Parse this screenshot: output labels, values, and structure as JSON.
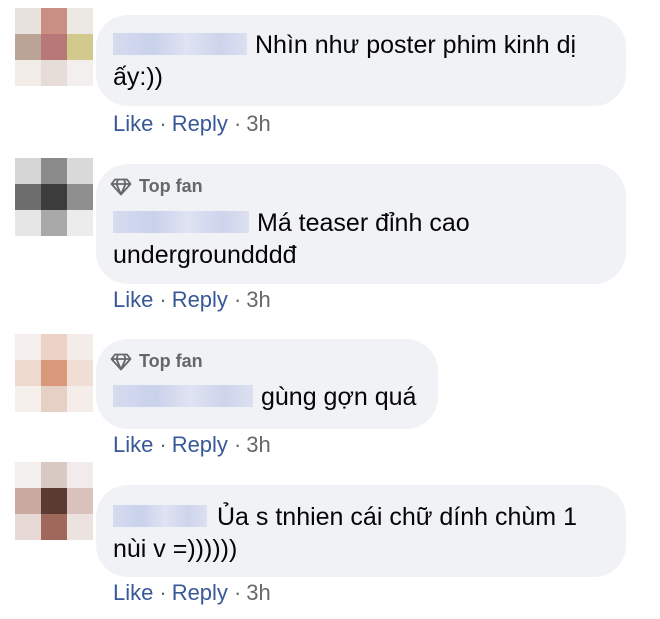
{
  "comments": [
    {
      "badge": "",
      "text_line1": "Nhìn như poster phim kinh dị",
      "text_line2": "ấy:))",
      "like": "Like",
      "reply": "Reply",
      "time": "3h",
      "avatar_colors": [
        "#e8e2df",
        "#c98f85",
        "#ece8e3",
        "#b9a496",
        "#b8787a",
        "#d4c98d",
        "#f1ece8",
        "#e6dcd8",
        "#f3efee"
      ]
    },
    {
      "badge": "Top fan",
      "text_line1": "Má teaser đỉnh cao",
      "text_line2": "undergroundddđ",
      "like": "Like",
      "reply": "Reply",
      "time": "3h",
      "avatar_colors": [
        "#d5d5d5",
        "#8a8a8a",
        "#d9d9d9",
        "#6d6d6d",
        "#3c3c3c",
        "#8f8f8f",
        "#e6e6e6",
        "#a8a8a8",
        "#ececec"
      ]
    },
    {
      "badge": "Top fan",
      "text_line1": "gùng gợn quá",
      "text_line2": "",
      "like": "Like",
      "reply": "Reply",
      "time": "3h",
      "avatar_colors": [
        "#f4efec",
        "#ecd2c6",
        "#f3ece8",
        "#eed9cf",
        "#d99879",
        "#f0ddd4",
        "#f6f0ed",
        "#e6cfc5",
        "#f4ede9"
      ]
    },
    {
      "badge": "",
      "text_line1": "Ủa s tnhien cái chữ dính chùm 1",
      "text_line2": "nùi v =))))))",
      "like": "Like",
      "reply": "Reply",
      "time": "3h",
      "avatar_colors": [
        "#f2efee",
        "#d9c9c3",
        "#f1eceb",
        "#c9aaa0",
        "#5a3a31",
        "#d8c2bb",
        "#e6d9d6",
        "#a0685a",
        "#ece3e0"
      ]
    }
  ],
  "badge_icon": "diamond-icon",
  "colors": {
    "bubble": "#f0f2f5",
    "link": "#385898",
    "meta": "#65676b",
    "text": "#050505"
  }
}
